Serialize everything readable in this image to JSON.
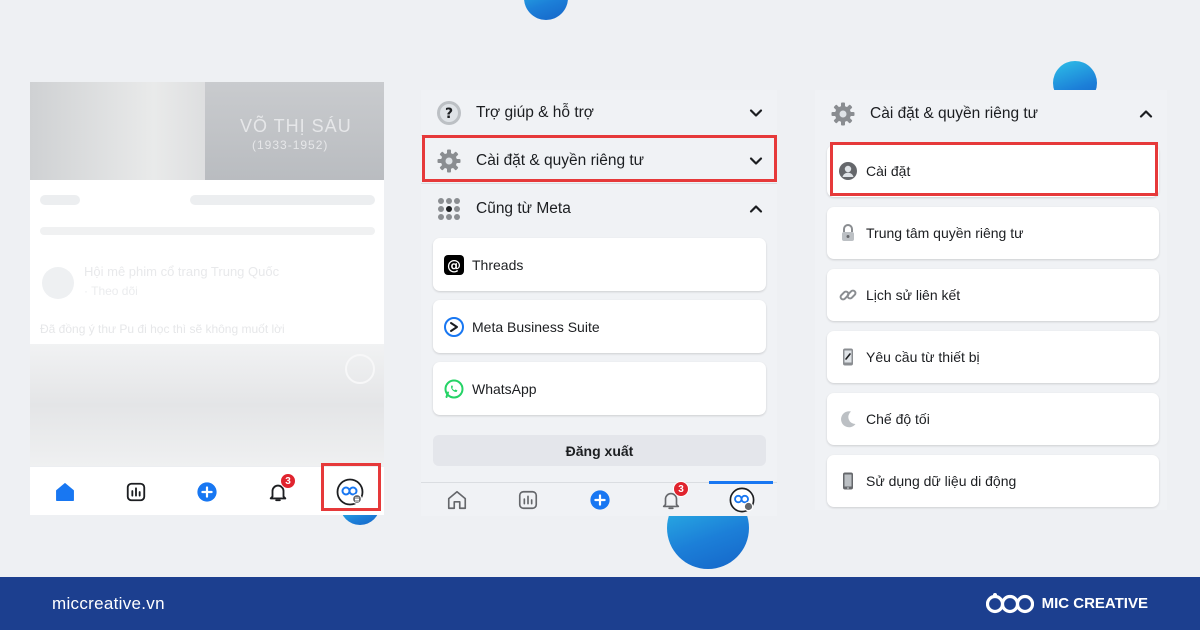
{
  "panel1": {
    "media_caption": "VÕ THỊ SÁU",
    "media_years": "(1933-1952)",
    "post_title": "Hội mê phim cổ trang Trung Quốc",
    "post_follow": "· Theo dõi",
    "post_text": "Đã đồng ý thư Pu đi học thì sẽ không muốt lời",
    "nav": {
      "notifications_badge": "3"
    }
  },
  "panel2": {
    "help_label": "Trợ giúp & hỗ trợ",
    "settings_label": "Cài đặt & quyền riêng tư",
    "meta_label": "Cũng từ Meta",
    "apps": [
      {
        "label": "Threads"
      },
      {
        "label": "Meta Business Suite"
      },
      {
        "label": "WhatsApp"
      }
    ],
    "logout_label": "Đăng xuất",
    "nav": {
      "notifications_badge": "3"
    }
  },
  "panel3": {
    "header_label": "Cài đặt & quyền riêng tư",
    "items": [
      {
        "label": "Cài đặt"
      },
      {
        "label": "Trung tâm quyền riêng tư"
      },
      {
        "label": "Lịch sử liên kết"
      },
      {
        "label": "Yêu cầu từ thiết bị"
      },
      {
        "label": "Chế độ tối"
      },
      {
        "label": "Sử dụng dữ liệu di động"
      }
    ]
  },
  "footer": {
    "site": "miccreative.vn",
    "brand": "MIC CREATIVE"
  },
  "colors": {
    "highlight": "#e6393a",
    "facebook_blue": "#1877f2",
    "footer_bg": "#1c3f8f"
  }
}
